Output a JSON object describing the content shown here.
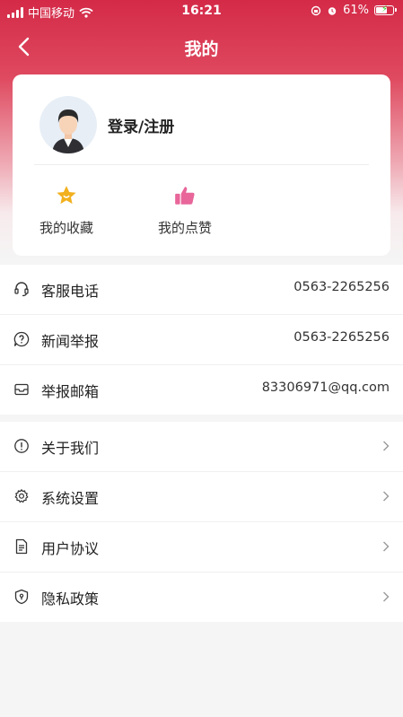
{
  "status_bar": {
    "carrier": "中国移动",
    "time": "16:21",
    "battery": "61%"
  },
  "nav": {
    "title": "我的"
  },
  "profile": {
    "login_label": "登录/注册",
    "quick_actions": [
      {
        "label": "我的收藏",
        "icon": "star-icon",
        "color": "#f2b01e"
      },
      {
        "label": "我的点赞",
        "icon": "thumbs-up-icon",
        "color": "#e8669a"
      }
    ]
  },
  "contact": [
    {
      "label": "客服电话",
      "value": "0563-2265256",
      "icon": "headset-icon"
    },
    {
      "label": "新闻举报",
      "value": "0563-2265256",
      "icon": "report-icon"
    },
    {
      "label": "举报邮箱",
      "value": "83306971@qq.com",
      "icon": "mail-icon"
    }
  ],
  "menu": [
    {
      "label": "关于我们",
      "icon": "info-icon"
    },
    {
      "label": "系统设置",
      "icon": "gear-icon"
    },
    {
      "label": "用户协议",
      "icon": "document-icon"
    },
    {
      "label": "隐私政策",
      "icon": "shield-icon"
    }
  ],
  "colors": {
    "brand": "#d42a48"
  }
}
